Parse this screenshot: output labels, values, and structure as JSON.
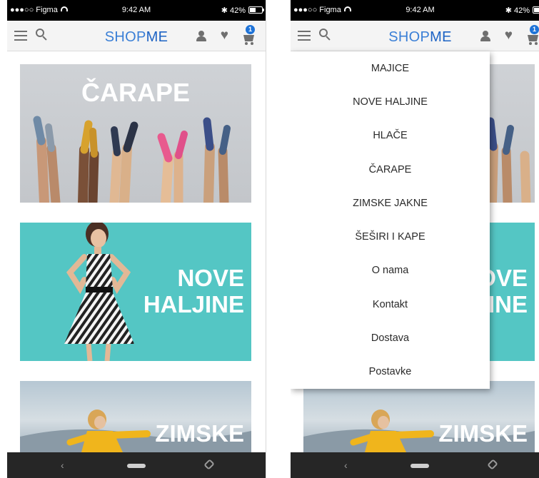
{
  "status_bar": {
    "carrier": "●●●○○ Figma",
    "time": "9:42 AM",
    "battery": "✱ 42%",
    "battery_level": 0.42
  },
  "app_bar": {
    "logo_part1": "SHOP",
    "logo_part2": "ME",
    "cart_count": "1",
    "icons": [
      "menu-icon",
      "search-icon",
      "user-icon",
      "heart-icon",
      "cart-icon"
    ]
  },
  "banners": [
    {
      "title": "ČARAPE"
    },
    {
      "title_line1": "NOVE",
      "title_line2": "HALJINE"
    },
    {
      "title": "ZIMSKE"
    }
  ],
  "menu": {
    "items": [
      "MAJICE",
      "NOVE HALJINE",
      "HLAČE",
      "ČARAPE",
      "ZIMSKE JAKNE",
      "ŠEŠIRI I KAPE",
      "O nama",
      "Kontakt",
      "Dostava",
      "Postavke"
    ]
  },
  "nav_bar": {
    "back_glyph": "‹"
  },
  "colors": {
    "accent": "#1e73d8",
    "logo": "#3a7fd6",
    "teal_banner": "#54c6c4",
    "grey_banner": "#c9ccd0",
    "status_bar": "#000000",
    "nav_bar": "#262626"
  }
}
